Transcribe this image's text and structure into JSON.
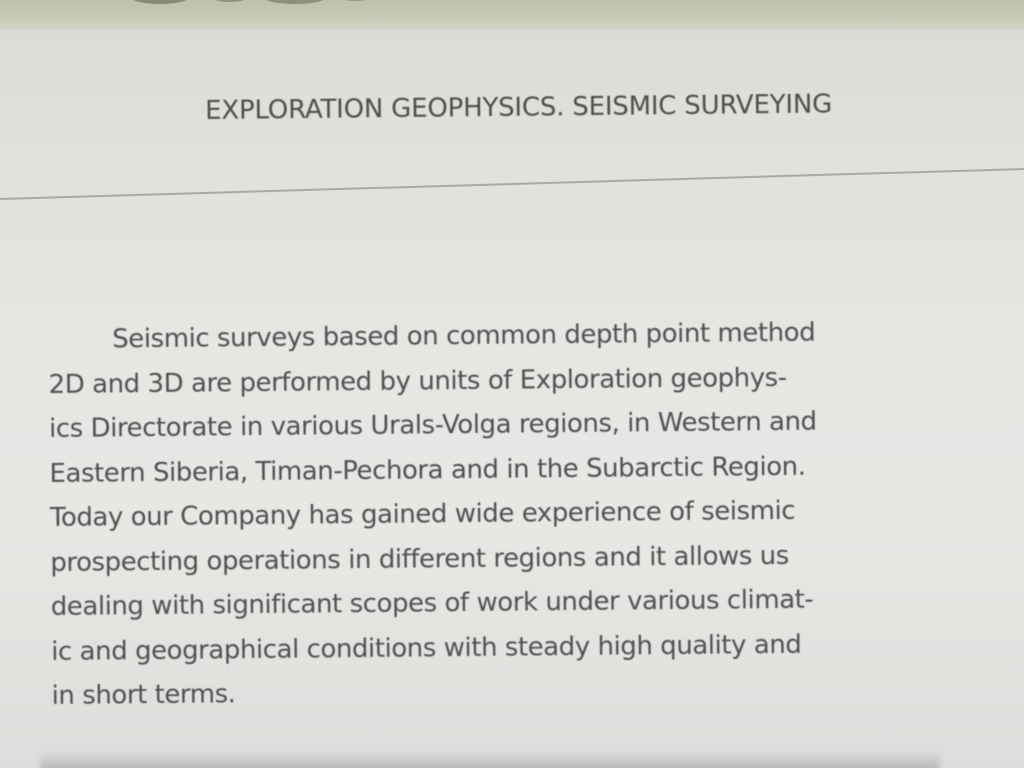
{
  "document": {
    "header": "EXPLORATION GEOPHYSICS. SEISMIC SURVEYING",
    "body_lines": [
      "Seismic surveys based on common depth point method",
      "2D and 3D are performed by units of Exploration geophys-",
      "ics Directorate in various Urals-Volga regions, in Western and",
      "Eastern Siberia, Timan-Pechora and in the Subarctic Region.",
      "Today our Company has gained wide experience of seismic",
      "prospecting operations in different regions and it allows us",
      "dealing with significant scopes of work under various climat-",
      "ic and geographical conditions with steady high quality and",
      "in short terms."
    ]
  },
  "colors": {
    "paper": "#e6e6e3",
    "ink": "#4f5152",
    "rule": "#a9aaa4",
    "top_strip": "#c8cab6"
  }
}
